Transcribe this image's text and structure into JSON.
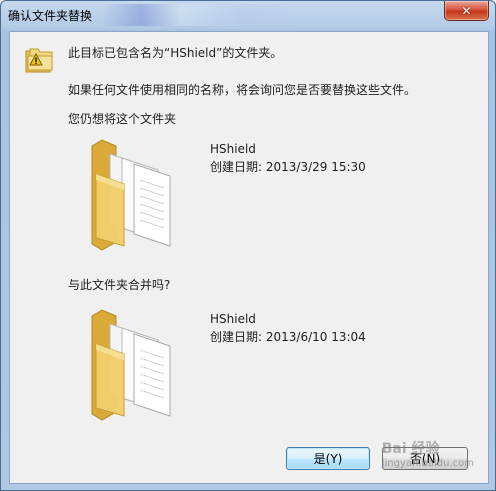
{
  "window": {
    "title": "确认文件夹替换",
    "close_glyph": "✕"
  },
  "message": {
    "line1": "此目标已包含名为“HShield”的文件夹。",
    "line2": "如果任何文件使用相同的名称，将会询问您是否要替换这些文件。",
    "prompt_keep": "您仍想将这个文件夹",
    "prompt_merge": "与此文件夹合并吗?"
  },
  "existing_folder": {
    "name": "HShield",
    "date_label": "创建日期: 2013/3/29 15:30"
  },
  "new_folder": {
    "name": "HShield",
    "date_label": "创建日期: 2013/6/10 13:04"
  },
  "buttons": {
    "yes_label": "是(Y)",
    "no_label": "否(N)"
  },
  "watermark": {
    "text": "Bai 经验",
    "sub": "jingyan.baidu.com"
  },
  "colors": {
    "folder_yellow": "#f2cf6b",
    "folder_dark": "#d9a93a",
    "default_button_border": "#3c7fb1"
  },
  "icons": [
    "warning-folder-icon",
    "folder-icon",
    "close-icon"
  ]
}
